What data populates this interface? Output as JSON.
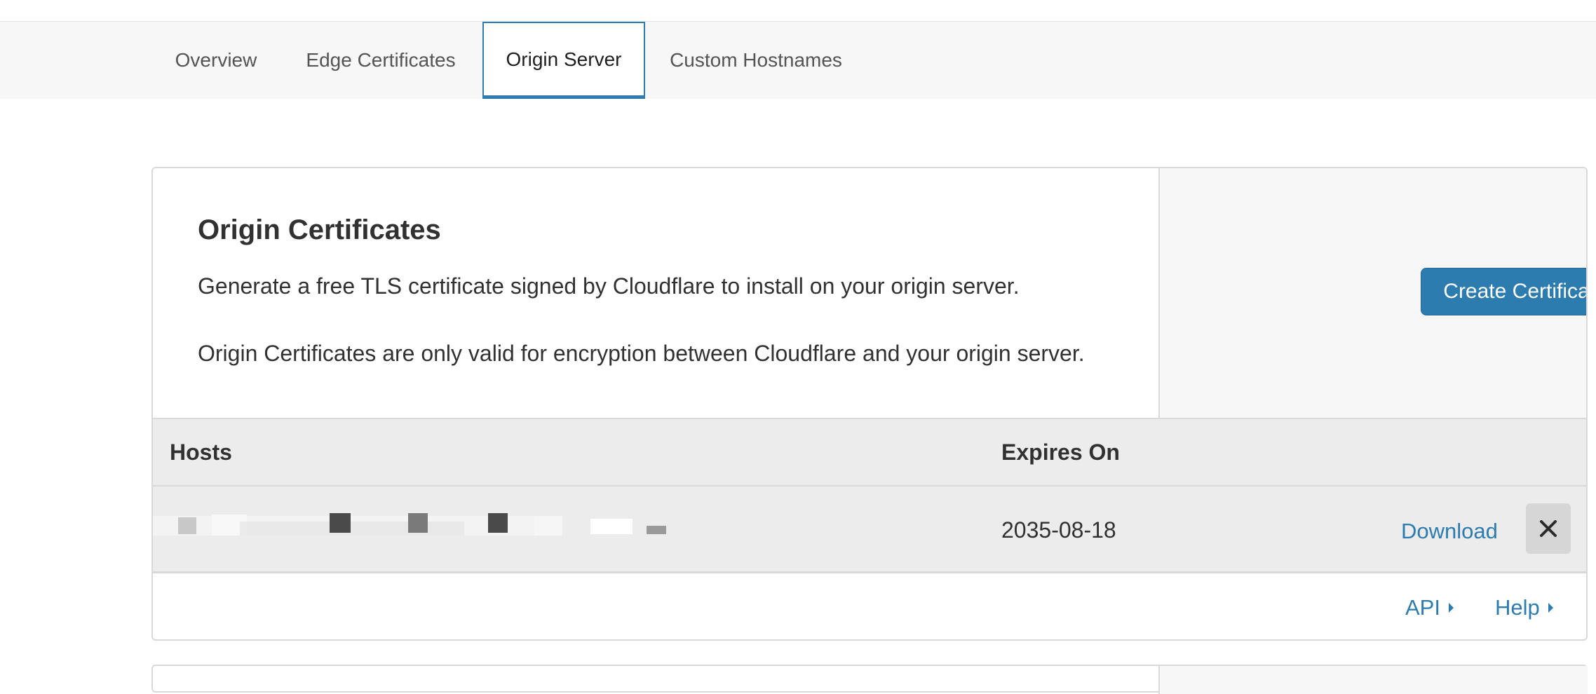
{
  "tabs": [
    {
      "label": "Overview",
      "active": false
    },
    {
      "label": "Edge Certificates",
      "active": false
    },
    {
      "label": "Origin Server",
      "active": true
    },
    {
      "label": "Custom Hostnames",
      "active": false
    }
  ],
  "origin_certificates": {
    "title": "Origin Certificates",
    "description_1": "Generate a free TLS certificate signed by Cloudflare to install on your origin server.",
    "description_2": "Origin Certificates are only valid for encryption between Cloudflare and your origin server.",
    "create_button": "Create Certificate"
  },
  "table": {
    "headers": {
      "hosts": "Hosts",
      "expires_on": "Expires On"
    },
    "rows": [
      {
        "hosts_redacted": true,
        "expires_on": "2035-08-18",
        "download_label": "Download",
        "delete_icon": "close-icon"
      }
    ]
  },
  "footer": {
    "api_label": "API",
    "help_label": "Help"
  },
  "colors": {
    "accent": "#2c7cb0",
    "tab_bar_bg": "#f7f7f8",
    "table_bg": "#ececec"
  }
}
